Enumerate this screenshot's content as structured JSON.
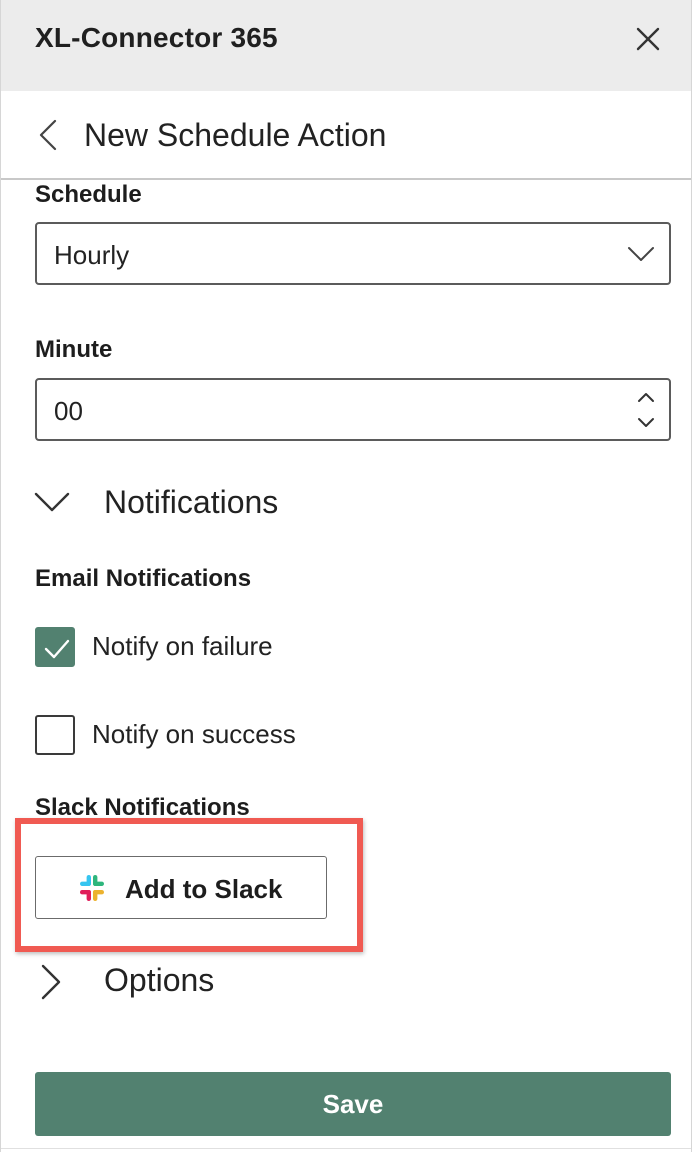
{
  "window": {
    "title": "XL-Connector 365",
    "close_icon": "close-icon"
  },
  "header": {
    "title": "New Schedule Action",
    "back_icon": "chevron-left-icon"
  },
  "schedule": {
    "label": "Schedule",
    "value": "Hourly"
  },
  "minute": {
    "label": "Minute",
    "value": "00"
  },
  "notifications": {
    "label": "Notifications",
    "expanded": true,
    "email_heading": "Email Notifications",
    "notify_failure": {
      "label": "Notify on failure",
      "checked": true
    },
    "notify_success": {
      "label": "Notify on success",
      "checked": false
    },
    "slack_heading": "Slack Notifications",
    "slack_button": "Add to Slack"
  },
  "options": {
    "label": "Options",
    "expanded": false
  },
  "save_label": "Save",
  "colors": {
    "accent": "#528170",
    "highlight": "#f05a52",
    "titlebar": "#ececec"
  }
}
